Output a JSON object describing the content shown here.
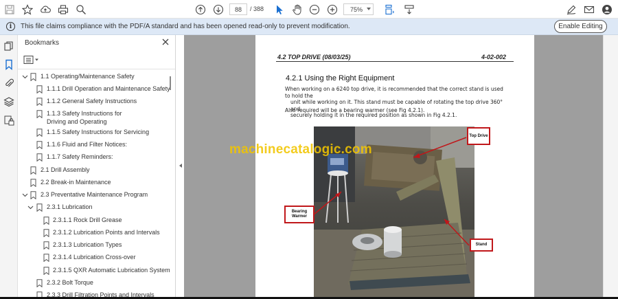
{
  "toolbar": {
    "page_current": "88",
    "page_total": "/ 388",
    "zoom": "75%"
  },
  "infobar": {
    "message": "This file claims compliance with the PDF/A standard and has been opened read-only to prevent modification.",
    "enable_label": "Enable Editing"
  },
  "bookmarks": {
    "title": "Bookmarks",
    "items": [
      {
        "label": "1.1 Operating/Maintenance Safety",
        "level": 1,
        "expanded": true
      },
      {
        "label": "1.1.1 Drill Operation and Maintenance Safety",
        "level": 2
      },
      {
        "label": "1.1.2 General Safety Instructions",
        "level": 2
      },
      {
        "label": "1.1.3 Safety Instructions for Driving and Operating",
        "level": 2
      },
      {
        "label": "1.1.5 Safety Instructions for Servicing",
        "level": 2
      },
      {
        "label": "1.1.6 Fluid and Filter Notices:",
        "level": 2
      },
      {
        "label": "1.1.7 Safety Reminders:",
        "level": 2
      },
      {
        "label": "2.1 Drill Assembly",
        "level": 1
      },
      {
        "label": "2.2 Break-in Maintenance",
        "level": 1
      },
      {
        "label": "2.3 Preventative Maintenance Program",
        "level": 1,
        "expanded": true
      },
      {
        "label": "2.3.1 Lubrication",
        "level": 2,
        "expanded": true
      },
      {
        "label": "2.3.1.1 Rock Drill Grease",
        "level": 3
      },
      {
        "label": "2.3.1.2 Lubrication Points and Intervals",
        "level": 3
      },
      {
        "label": "2.3.1.3 Lubrication Types",
        "level": 3
      },
      {
        "label": "2.3.1.4 Lubrication Cross-over",
        "level": 3
      },
      {
        "label": "2.3.1.5 QXR Automatic Lubrication System",
        "level": 3
      },
      {
        "label": "2.3.2 Bolt Torque",
        "level": 2
      },
      {
        "label": "2.3.3 Drill Filtration Points and Intervals",
        "level": 2
      }
    ]
  },
  "document": {
    "header_left": "4.2 TOP DRIVE   (08/03/25)",
    "header_right": "4-02-002",
    "section_title": "4.2.1 Using the Right Equipment",
    "para1_line1": "When working on a 6240 top drive, it is recommended that the correct stand is used to hold the",
    "para1_line2": "unit while working on it. This stand must be capable of rotating the top drive 360° and",
    "para1_line3": "securely holding it in the required position as shown in Fig 4.2.1.",
    "para2": "Also required will be a bearing warmer (see Fig 4.2.1).",
    "callouts": {
      "top_drive": "Top Drive",
      "bearing_warmer": "Bearing Warmer",
      "stand": "Stand"
    }
  },
  "watermark": "machinecatalogic.com",
  "colors": {
    "accent_blue": "#1a6fd1",
    "info_bar": "#dde8f6",
    "callout_red": "#c0171a",
    "watermark": "#f2c500",
    "doc_background": "#9e9e9e"
  }
}
